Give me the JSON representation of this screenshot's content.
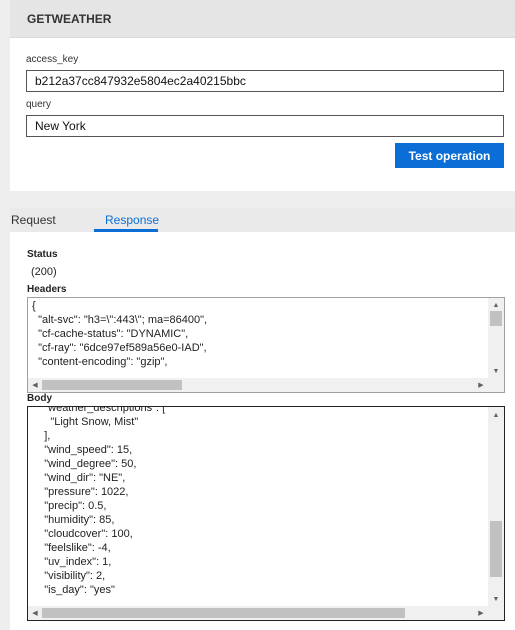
{
  "header": {
    "title": "GETWEATHER"
  },
  "form": {
    "fields": [
      {
        "label": "access_key",
        "value": "b212a37cc847932e5804ec2a40215bbc"
      },
      {
        "label": "query",
        "value": "New York"
      }
    ],
    "test_button_label": "Test operation"
  },
  "tabs": [
    {
      "label": "Request",
      "selected": false
    },
    {
      "label": "Response",
      "selected": true
    }
  ],
  "response": {
    "status_label": "Status",
    "status_value": "(200)",
    "headers_label": "Headers",
    "headers_lines": [
      "{",
      "  \"alt-svc\": \"h3=\\\":443\\\"; ma=86400\",",
      "  \"cf-cache-status\": \"DYNAMIC\",",
      "  \"cf-ray\": \"6dce97ef589a56e0-IAD\",",
      "  \"content-encoding\": \"gzip\","
    ],
    "body_label": "Body",
    "body_lines": [
      "    \"weather_descriptions\": [",
      "      \"Light Snow, Mist\"",
      "    ],",
      "    \"wind_speed\": 15,",
      "    \"wind_degree\": 50,",
      "    \"wind_dir\": \"NE\",",
      "    \"pressure\": 1022,",
      "    \"precip\": 0.5,",
      "    \"humidity\": 85,",
      "    \"cloudcover\": 100,",
      "    \"feelslike\": -4,",
      "    \"uv_index\": 1,",
      "    \"visibility\": 2,",
      "    \"is_day\": \"yes\""
    ]
  },
  "icons": {
    "up": "▲",
    "down": "▼",
    "left": "◀",
    "right": "▶"
  },
  "colors": {
    "accent": "#0b6ed6",
    "header_bg": "#e5e5e5",
    "page_bg": "#eeeeee"
  }
}
